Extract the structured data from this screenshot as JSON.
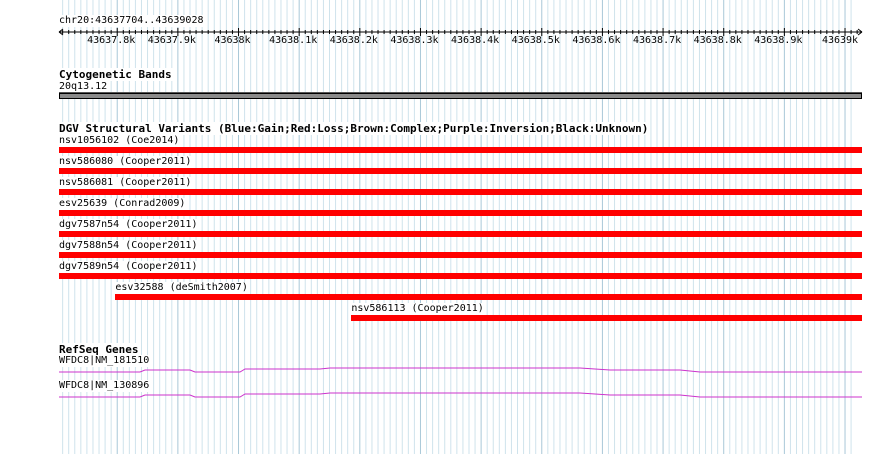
{
  "ruler": {
    "region": "chr20:43637704..43639028",
    "ticks": [
      "43637.8k",
      "43637.9k",
      "43638k",
      "43638.1k",
      "43638.2k",
      "43638.3k",
      "43638.4k",
      "43638.5k",
      "43638.6k",
      "43638.7k",
      "43638.8k",
      "43638.9k",
      "43639k"
    ]
  },
  "tracks": {
    "cytoband": {
      "title": "Cytogenetic Bands",
      "band_label": "20q13.12"
    },
    "dgv": {
      "title": "DGV Structural Variants (Blue:Gain;Red:Loss;Brown:Complex;Purple:Inversion;Black:Unknown)",
      "loss_color": "#ff0000",
      "features": [
        {
          "label": "nsv1056102 (Coe2014)",
          "start": 43637704,
          "end": 43639028
        },
        {
          "label": "nsv586080 (Cooper2011)",
          "start": 43637704,
          "end": 43639028
        },
        {
          "label": "nsv586081 (Cooper2011)",
          "start": 43637704,
          "end": 43639028
        },
        {
          "label": "esv25639 (Conrad2009)",
          "start": 43637704,
          "end": 43639028
        },
        {
          "label": "dgv7587n54 (Cooper2011)",
          "start": 43637704,
          "end": 43639028
        },
        {
          "label": "dgv7588n54 (Cooper2011)",
          "start": 43637704,
          "end": 43639028
        },
        {
          "label": "dgv7589n54 (Cooper2011)",
          "start": 43637704,
          "end": 43639028
        },
        {
          "label": "esv32588 (deSmith2007)",
          "start": 43637797,
          "end": 43639028
        },
        {
          "label": "nsv586113 (Cooper2011)",
          "start": 43638186,
          "end": 43639028
        }
      ]
    },
    "refseq": {
      "title": "RefSeq Genes",
      "color": "#cc33cc",
      "genes": [
        {
          "label": "WFDC8|NM_181510"
        },
        {
          "label": "WFDC8|NM_130896"
        }
      ]
    }
  }
}
